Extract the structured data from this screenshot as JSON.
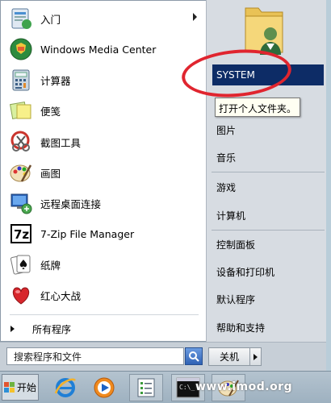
{
  "left_pane": {
    "programs": [
      {
        "label": "入门",
        "icon": "getting-started-icon",
        "has_submenu": true
      },
      {
        "label": "Windows Media Center",
        "icon": "media-center-icon",
        "has_submenu": false
      },
      {
        "label": "计算器",
        "icon": "calculator-icon",
        "has_submenu": false
      },
      {
        "label": "便笺",
        "icon": "sticky-notes-icon",
        "has_submenu": false
      },
      {
        "label": "截图工具",
        "icon": "snipping-tool-icon",
        "has_submenu": false
      },
      {
        "label": "画图",
        "icon": "paint-icon",
        "has_submenu": false
      },
      {
        "label": "远程桌面连接",
        "icon": "remote-desktop-icon",
        "has_submenu": false
      },
      {
        "label": "7-Zip File Manager",
        "icon": "7zip-icon",
        "has_submenu": false
      },
      {
        "label": "纸牌",
        "icon": "solitaire-icon",
        "has_submenu": false
      },
      {
        "label": "红心大战",
        "icon": "hearts-icon",
        "has_submenu": false
      }
    ],
    "all_programs_label": "所有程序"
  },
  "right_pane": {
    "user_name": "SYSTEM",
    "tooltip": "打开个人文件夹。",
    "items": [
      "图片",
      "音乐",
      "游戏",
      "计算机",
      "控制面板",
      "设备和打印机",
      "默认程序",
      "帮助和支持"
    ]
  },
  "bottom": {
    "search_placeholder": "搜索程序和文件",
    "shutdown_label": "关机"
  },
  "taskbar": {
    "start_label": "开始",
    "watermark": "www.imod.org",
    "pinned": [
      "internet-explorer-icon",
      "media-player-icon",
      "task-list-icon",
      "command-prompt-icon",
      "paint-icon"
    ]
  },
  "colors": {
    "highlight": "#0d2c66",
    "annotation_ring": "#e0252f"
  }
}
